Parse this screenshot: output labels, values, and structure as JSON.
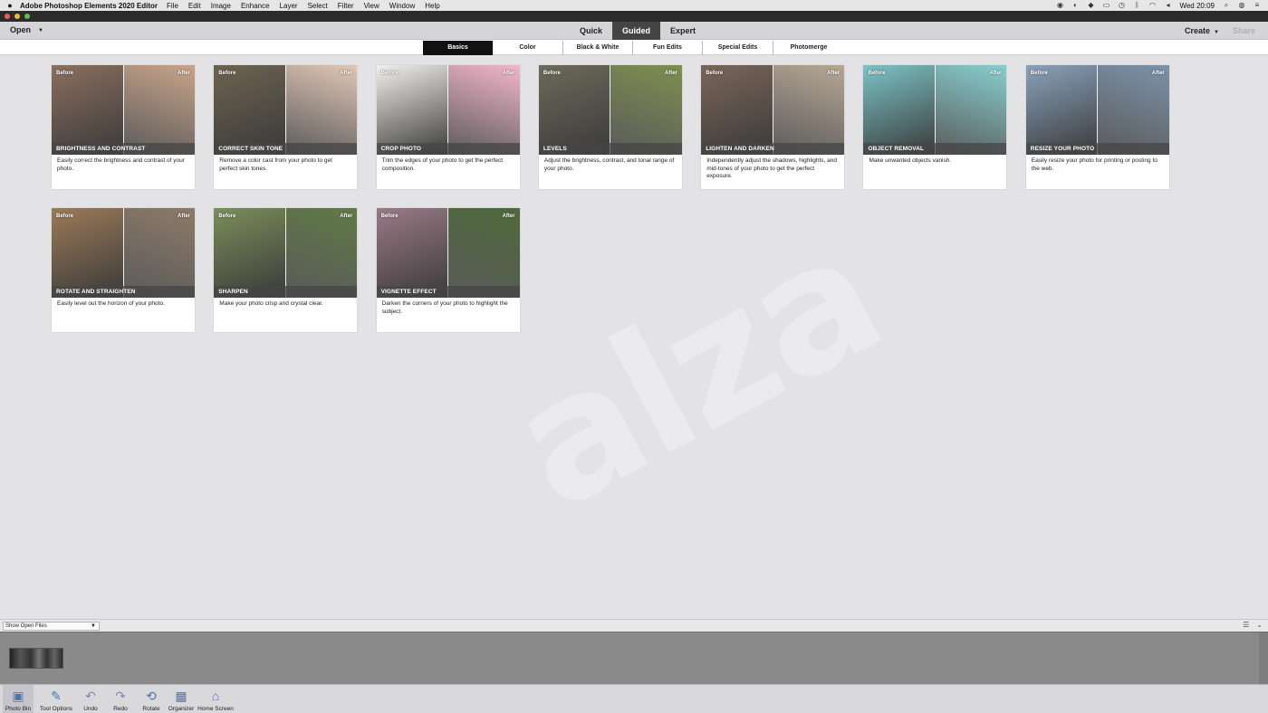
{
  "menubar": {
    "app_name": "Adobe Photoshop Elements 2020 Editor",
    "items": [
      "File",
      "Edit",
      "Image",
      "Enhance",
      "Layer",
      "Select",
      "Filter",
      "View",
      "Window",
      "Help"
    ],
    "clock": "Wed 20:09"
  },
  "modebar": {
    "open_label": "Open",
    "tabs": [
      "Quick",
      "Guided",
      "Expert"
    ],
    "active_tab": "Guided",
    "create_label": "Create",
    "share_label": "Share"
  },
  "subtabs": {
    "items": [
      "Basics",
      "Color",
      "Black & White",
      "Fun Edits",
      "Special Edits",
      "Photomerge"
    ],
    "active": "Basics"
  },
  "cards": [
    {
      "title": "Brightness and Contrast",
      "before": "Before",
      "after": "After",
      "desc": "Easily correct the brightness and contrast of your photo.",
      "colors": [
        "#8a6f5e",
        "#c9a48a"
      ]
    },
    {
      "title": "Correct Skin Tone",
      "before": "Before",
      "after": "After",
      "desc": "Remove a color cast from your photo to get perfect skin tones.",
      "colors": [
        "#6d6350",
        "#e1c7b6"
      ]
    },
    {
      "title": "Crop Photo",
      "before": "Before",
      "after": "After",
      "desc": "Trim the edges of your photo to get the perfect composition.",
      "colors": [
        "#f2f0ec",
        "#f3b6cb"
      ]
    },
    {
      "title": "Levels",
      "before": "Before",
      "after": "After",
      "desc": "Adjust the brightness, contrast, and tonal range of your photo.",
      "colors": [
        "#6d6a5a",
        "#7e8f50"
      ]
    },
    {
      "title": "Lighten and Darken",
      "before": "Before",
      "after": "After",
      "desc": "Independently adjust the shadows, highlights, and mid-tones of your photo to get the perfect exposure.",
      "colors": [
        "#7a6658",
        "#b8a895"
      ]
    },
    {
      "title": "Object Removal",
      "before": "Before",
      "after": "After",
      "desc": "Make unwanted objects vanish.",
      "colors": [
        "#7cc3c6",
        "#88cfd0"
      ]
    },
    {
      "title": "Resize Your Photo",
      "before": "Before",
      "after": "After",
      "desc": "Easily resize your photo for printing or posting to the web.",
      "colors": [
        "#8aa2bb",
        "#7c93a9"
      ]
    },
    {
      "title": "Rotate and Straighten",
      "before": "Before",
      "after": "After",
      "desc": "Easily level out the horizon of your photo.",
      "colors": [
        "#9b7a58",
        "#8d7a68"
      ]
    },
    {
      "title": "Sharpen",
      "before": "Before",
      "after": "After",
      "desc": "Make your photo crisp and crystal clear.",
      "colors": [
        "#7a8e5a",
        "#5f7a45"
      ]
    },
    {
      "title": "Vignette Effect",
      "before": "Before",
      "after": "After",
      "desc": "Darken the corners of your photo to highlight the subject.",
      "colors": [
        "#9a7a86",
        "#4e6a3a"
      ]
    }
  ],
  "bin": {
    "select_label": "Show Open Files"
  },
  "taskbar": {
    "buttons": [
      {
        "label": "Photo Bin",
        "icon": "photo-bin-icon",
        "glyph": "▣"
      },
      {
        "label": "Tool Options",
        "icon": "tool-options-icon",
        "glyph": "✎"
      },
      {
        "label": "Undo",
        "icon": "undo-icon",
        "glyph": "↶"
      },
      {
        "label": "Redo",
        "icon": "redo-icon",
        "glyph": "↷"
      },
      {
        "label": "Rotate",
        "icon": "rotate-icon",
        "glyph": "⟲"
      },
      {
        "label": "Organizer",
        "icon": "organizer-icon",
        "glyph": "▦"
      },
      {
        "label": "Home Screen",
        "icon": "home-icon",
        "glyph": "⌂"
      }
    ]
  },
  "watermark": "alza"
}
